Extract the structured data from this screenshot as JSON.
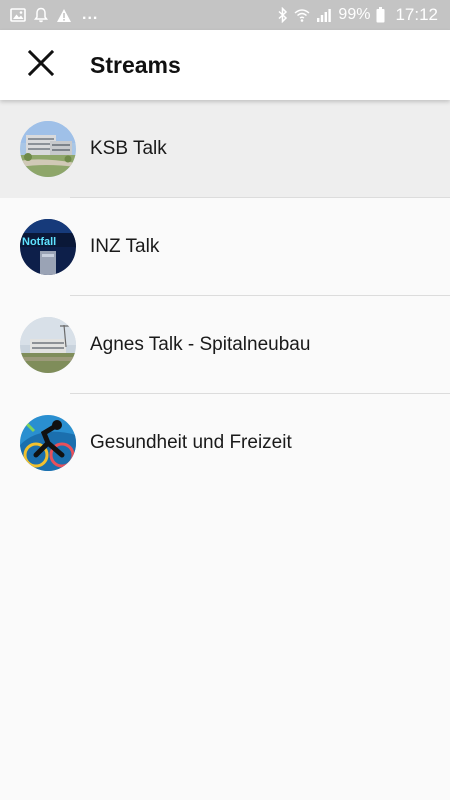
{
  "status_bar": {
    "battery_percent": "99%",
    "time": "17:12",
    "dots": "...",
    "icons": [
      "image-icon",
      "bell-icon",
      "warning-icon",
      "bluetooth-icon",
      "wifi-icon",
      "signal-icon",
      "battery-icon"
    ]
  },
  "app_bar": {
    "title": "Streams",
    "close_icon": "close-icon"
  },
  "streams": [
    {
      "label": "KSB Talk",
      "selected": true,
      "avatar": "building-photo"
    },
    {
      "label": "INZ Talk",
      "selected": false,
      "avatar": "notfall-sign-photo",
      "avatar_text": "Notfall"
    },
    {
      "label": "Agnes Talk - Spitalneubau",
      "selected": false,
      "avatar": "construction-photo"
    },
    {
      "label": "Gesundheit und Freizeit",
      "selected": false,
      "avatar": "cyclist-illustration"
    }
  ],
  "colors": {
    "status_bar_bg": "#c4c4c4",
    "app_bar_bg": "#ffffff",
    "list_bg": "#fafafa",
    "selected_bg": "#eeeeee",
    "divider": "#dcdcdc"
  }
}
